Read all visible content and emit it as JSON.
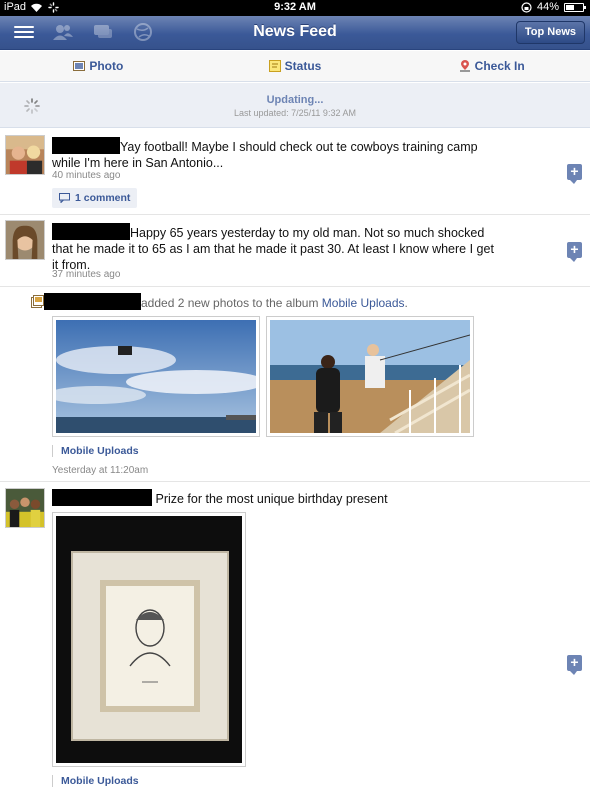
{
  "status_bar": {
    "carrier": "iPad",
    "time": "9:32 AM",
    "battery": "44%"
  },
  "nav": {
    "title": "News Feed",
    "top_news": "Top News"
  },
  "publisher": {
    "photo": "Photo",
    "status": "Status",
    "check_in": "Check In"
  },
  "updating": {
    "label": "Updating...",
    "last_updated": "Last updated: 7/25/11 9:32 AM"
  },
  "stories": {
    "s1": {
      "text_a": "Yay football! Maybe I should check out te cowboys training camp",
      "text_b": "while I'm here in San Antonio...",
      "time": "40 minutes ago",
      "comments": "1 comment"
    },
    "s2": {
      "text_a": "Happy 65 years yesterday to my old man. Not so much shocked",
      "text_b": "that he made it to 65 as I am that he made it past 30. At least I know where I get",
      "text_c": "it from.",
      "time": "37 minutes ago"
    },
    "s3": {
      "text_pre": "added 2 new photos to the album ",
      "album": "Mobile Uploads",
      "text_post": ".",
      "album_link": "Mobile Uploads",
      "time": "Yesterday at 11:20am"
    },
    "s4": {
      "text": "Prize for the most unique birthday present",
      "album_link": "Mobile Uploads"
    }
  },
  "colors": {
    "facebook_blue": "#3b5998",
    "nav_gradient_top": "#6d84b4"
  }
}
